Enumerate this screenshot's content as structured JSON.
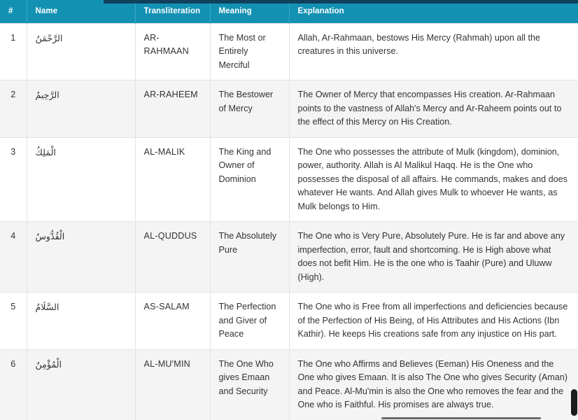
{
  "page": {
    "accent_color": "#1391b3",
    "stripe_color": "#f4f4f4",
    "border_color": "#e3e3e3",
    "top_strip_color": "#10405c",
    "text_color": "#2f3337"
  },
  "table": {
    "columns": [
      {
        "key": "index",
        "label": "#"
      },
      {
        "key": "name",
        "label": "Name"
      },
      {
        "key": "transliteration",
        "label": "Transliteration"
      },
      {
        "key": "meaning",
        "label": "Meaning"
      },
      {
        "key": "explanation",
        "label": "Explanation"
      }
    ],
    "rows": [
      {
        "index": "1",
        "name": "الرَّحْمَنُ",
        "transliteration": "AR-RAHMAAN",
        "meaning": "The Most or Entirely Merciful",
        "explanation": "Allah, Ar-Rahmaan, bestows His Mercy (Rahmah) upon all the creatures in this universe."
      },
      {
        "index": "2",
        "name": "الرَّحِيمُ",
        "transliteration": "AR-RAHEEM",
        "meaning": "The Bestower of Mercy",
        "explanation": "The Owner of Mercy that encompasses His creation. Ar-Rahmaan points to the vastness of Allah's Mercy and Ar-Raheem points out to the effect of this Mercy on His Creation."
      },
      {
        "index": "3",
        "name": "الْمَلِكُ",
        "transliteration": "AL-MALIK",
        "meaning": "The King and Owner of Dominion",
        "explanation": "The One who possesses the attribute of Mulk (kingdom), dominion, power, authority. Allah is Al Malikul Haqq. He is the One who possesses the disposal of all affairs. He commands, makes and does whatever He wants. And Allah gives Mulk to whoever He wants, as Mulk belongs to Him."
      },
      {
        "index": "4",
        "name": "الْقُدُّوسُ",
        "transliteration": "AL-QUDDUS",
        "meaning": "The Absolutely Pure",
        "explanation": "The One who is Very Pure, Absolutely Pure. He is far and above any imperfection, error, fault and shortcoming. He is High above what does not befit Him. He is the one who is Taahir (Pure) and Uluww (High)."
      },
      {
        "index": "5",
        "name": "السَّلَامُ",
        "transliteration": "AS-SALAM",
        "meaning": "The Perfection and Giver of Peace",
        "explanation": "The One who is Free from all imperfections and deficiencies because of the Perfection of His Being, of His Attributes and His Actions (Ibn Kathir). He keeps His creations safe from any injustice on His part."
      },
      {
        "index": "6",
        "name": "الْمُؤْمِنُ",
        "transliteration": "AL-MU'MIN",
        "meaning": "The One Who gives Emaan and Security",
        "explanation": "The One who Affirms and Believes (Eeman) His Oneness and the One who gives Emaan. It is also The One who gives Security (Aman) and Peace. Al-Mu'min is also the One who removes the fear and the One who is Faithful. His promises are always true."
      }
    ]
  }
}
